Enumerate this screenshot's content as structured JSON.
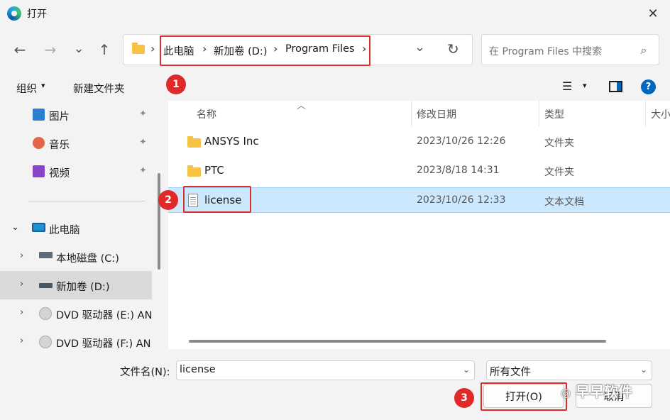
{
  "window": {
    "title": "打开",
    "close_icon": "✕"
  },
  "nav": {
    "back_icon": "←",
    "forward_icon": "→",
    "recent_icon": "⌄",
    "up_icon": "↑",
    "breadcrumbs": [
      "此电脑",
      "新加卷 (D:)",
      "Program Files"
    ],
    "separator": "›",
    "dropdown_icon": "⌄",
    "refresh_icon": "↻",
    "search_placeholder": "在 Program Files 中搜索",
    "search_icon": "⌕"
  },
  "commandbar": {
    "organize": "组织",
    "organize_arrow": "▾",
    "new_folder": "新建文件夹",
    "view_icon": "☰",
    "view_arrow": "▾",
    "help_icon": "?"
  },
  "sidebar": {
    "pinned": [
      {
        "label": "图片",
        "icon": "pictures-icon"
      },
      {
        "label": "音乐",
        "icon": "music-icon"
      },
      {
        "label": "视频",
        "icon": "videos-icon"
      }
    ],
    "pin_icon": "📌",
    "this_pc": "此电脑",
    "drives": [
      {
        "label": "本地磁盘 (C:)"
      },
      {
        "label": "新加卷 (D:)",
        "selected": true
      },
      {
        "label": "DVD 驱动器 (E:) AN"
      },
      {
        "label": "DVD 驱动器 (F:) AN"
      }
    ]
  },
  "filelist": {
    "columns": {
      "name": "名称",
      "modified": "修改日期",
      "type": "类型",
      "size": "大小"
    },
    "sort_indicator": "︿",
    "rows": [
      {
        "name": "ANSYS Inc",
        "modified": "2023/10/26 12:26",
        "type": "文件夹",
        "icon": "folder-icon"
      },
      {
        "name": "PTC",
        "modified": "2023/8/18 14:31",
        "type": "文件夹",
        "icon": "folder-icon"
      },
      {
        "name": "license",
        "modified": "2023/10/26 12:33",
        "type": "文本文档",
        "icon": "text-file-icon",
        "selected": true
      }
    ]
  },
  "bottom": {
    "filename_label": "文件名(N):",
    "filename_value": "license",
    "filter_value": "所有文件",
    "open_button": "打开(O)",
    "cancel_button": "取消"
  },
  "annotations": {
    "step1": "1",
    "step2": "2",
    "step3": "3",
    "highlight_color": "#d9302a"
  },
  "watermark": "早早软件"
}
